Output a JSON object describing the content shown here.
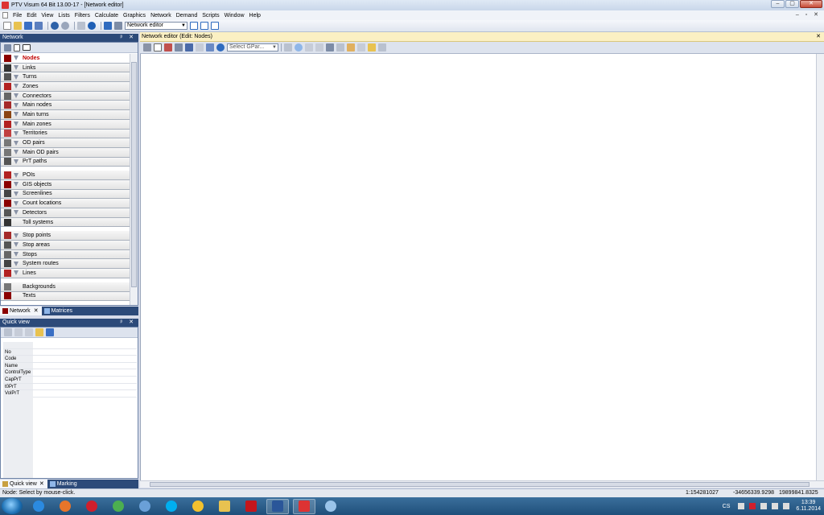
{
  "window": {
    "title": "PTV Visum 64 Bit 13.00-17 - [Network editor]",
    "controls": [
      "–",
      "▢",
      "✕"
    ]
  },
  "menu": [
    "File",
    "Edit",
    "View",
    "Lists",
    "Filters",
    "Calculate",
    "Graphics",
    "Network",
    "Demand",
    "Scripts",
    "Window",
    "Help"
  ],
  "toolbar": {
    "view_combo": "Network editor"
  },
  "network_panel": {
    "title": "Network",
    "pin": "ᵖ ✕",
    "groups": [
      [
        {
          "label": "Nodes",
          "icon": "node-icon",
          "color": "#8b0000",
          "filter": true,
          "selected": true
        },
        {
          "label": "Links",
          "icon": "link-icon",
          "color": "#333333",
          "filter": true
        },
        {
          "label": "Turns",
          "icon": "turn-icon",
          "color": "#555555",
          "filter": true
        },
        {
          "label": "Zones",
          "icon": "zone-icon",
          "color": "#b22222",
          "filter": true
        },
        {
          "label": "Connectors",
          "icon": "connector-icon",
          "color": "#666666",
          "filter": true
        },
        {
          "label": "Main nodes",
          "icon": "main-node-icon",
          "color": "#a52a2a",
          "filter": true
        },
        {
          "label": "Main turns",
          "icon": "main-turn-icon",
          "color": "#8b4513",
          "filter": true
        },
        {
          "label": "Main zones",
          "icon": "main-zone-icon",
          "color": "#b22222",
          "filter": true
        },
        {
          "label": "Territories",
          "icon": "territory-icon",
          "color": "#c04040",
          "filter": true
        },
        {
          "label": "OD pairs",
          "icon": "od-pair-icon",
          "color": "#777777",
          "filter": true
        },
        {
          "label": "Main OD pairs",
          "icon": "main-od-pair-icon",
          "color": "#777777",
          "filter": true
        },
        {
          "label": "PrT paths",
          "icon": "prt-path-icon",
          "color": "#555555",
          "filter": true
        }
      ],
      [
        {
          "label": "POIs",
          "icon": "poi-icon",
          "color": "#b22222",
          "filter": true
        },
        {
          "label": "GIS objects",
          "icon": "gis-object-icon",
          "color": "#8b0000",
          "filter": true
        },
        {
          "label": "Screenlines",
          "icon": "screenline-icon",
          "color": "#444444",
          "filter": true
        },
        {
          "label": "Count locations",
          "icon": "count-location-icon",
          "color": "#8b0000",
          "filter": true
        },
        {
          "label": "Detectors",
          "icon": "detector-icon",
          "color": "#555555",
          "filter": true
        },
        {
          "label": "Toll systems",
          "icon": "toll-system-icon",
          "color": "#333333",
          "filter": false
        }
      ],
      [
        {
          "label": "Stop points",
          "icon": "stop-point-icon",
          "color": "#a52a2a",
          "filter": true
        },
        {
          "label": "Stop areas",
          "icon": "stop-area-icon",
          "color": "#555555",
          "filter": true
        },
        {
          "label": "Stops",
          "icon": "stop-icon",
          "color": "#666666",
          "filter": true
        },
        {
          "label": "System routes",
          "icon": "system-route-icon",
          "color": "#444444",
          "filter": true
        },
        {
          "label": "Lines",
          "icon": "line-icon",
          "color": "#b22222",
          "filter": true
        }
      ],
      [
        {
          "label": "Backgrounds",
          "icon": "background-icon",
          "color": "#777777",
          "filter": false
        },
        {
          "label": "Texts",
          "icon": "text-icon",
          "color": "#8b0000",
          "filter": false
        }
      ]
    ],
    "tabs": [
      "Network",
      "Matrices"
    ]
  },
  "quick_view": {
    "title": "Quick view",
    "fields": [
      "No",
      "Code",
      "Name",
      "ControlType",
      "CapPrT",
      "t0PrT",
      "VolPrT"
    ],
    "tabs": [
      "Quick view",
      "Marking"
    ]
  },
  "editor": {
    "title": "Network editor (Edit: Nodes)",
    "gpar_placeholder": "Select GPar...",
    "close": "✕"
  },
  "status": {
    "message": "Node: Select by mouse-click.",
    "scale": "1:154281027",
    "x": "-34656339.9298",
    "y": "19899841.8325"
  },
  "taskbar": {
    "lang": "CS",
    "time": "13:39",
    "date": "6.11.2014"
  }
}
